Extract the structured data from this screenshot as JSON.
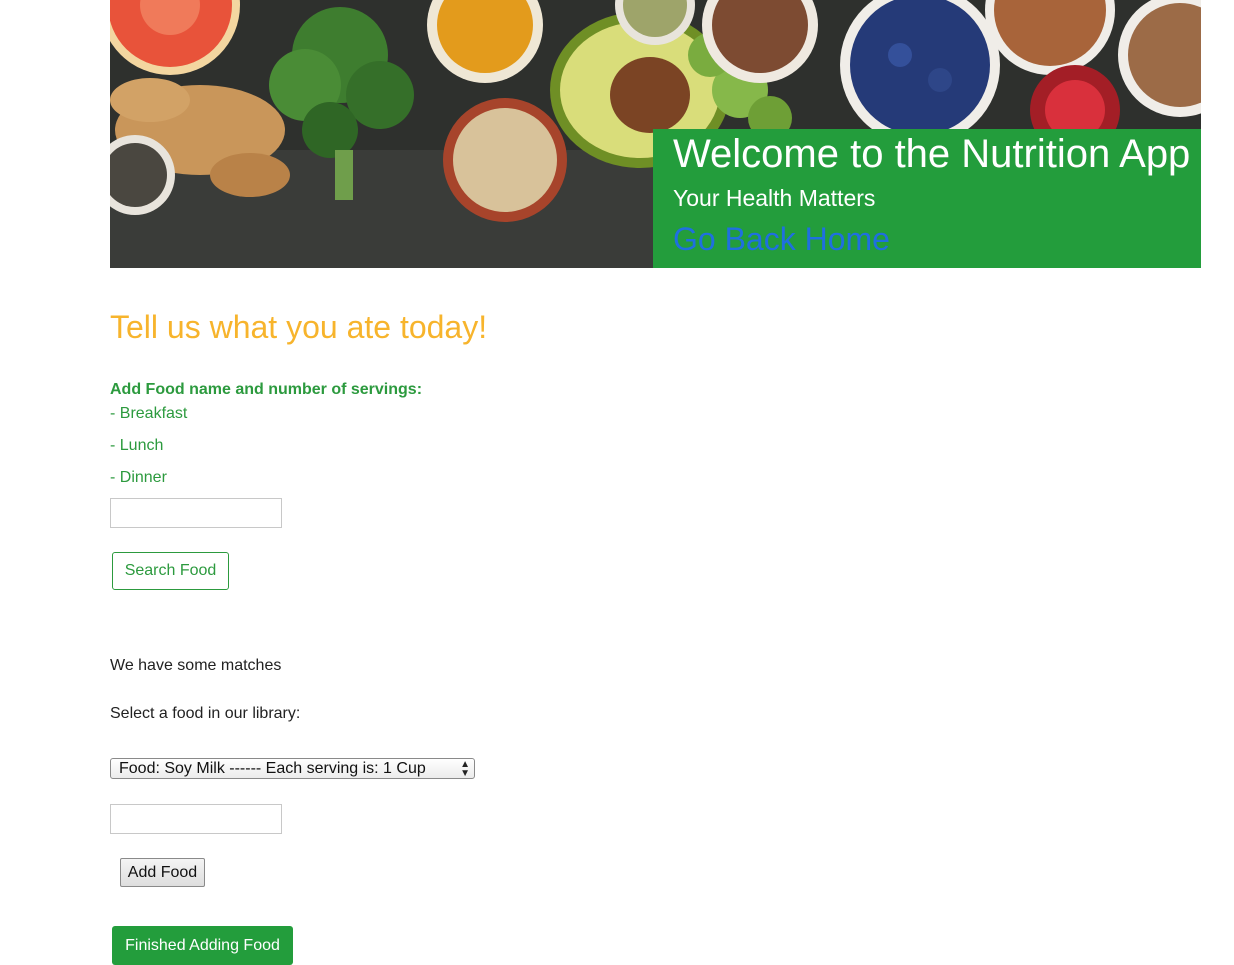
{
  "hero": {
    "title": "Welcome to the Nutrition App",
    "subtitle": "Your Health Matters",
    "home_link": "Go Back Home",
    "image_desc": "assorted healthy foods: grapefruit, ginger, broccoli, turmeric, oats, avocado, nuts, blueberries, pomegranate, chia seeds"
  },
  "main": {
    "heading": "Tell us what you ate today!",
    "instructions": "Add Food name and number of servings:",
    "meals": [
      "- Breakfast",
      "- Lunch",
      "- Dinner"
    ],
    "search_input": {
      "value": "",
      "placeholder": ""
    },
    "search_button": "Search Food",
    "matches_text": "We have some matches",
    "select_prompt": "Select a food in our library:",
    "food_select": {
      "selected": "Food: Soy Milk ------ Each serving is: 1 Cup"
    },
    "servings_input": {
      "value": "",
      "placeholder": ""
    },
    "add_button": "Add Food",
    "finish_button": "Finished Adding Food"
  },
  "colors": {
    "brand_green": "#239d3c",
    "heading_orange": "#f7b42c",
    "link_blue": "#1f6fe0"
  }
}
